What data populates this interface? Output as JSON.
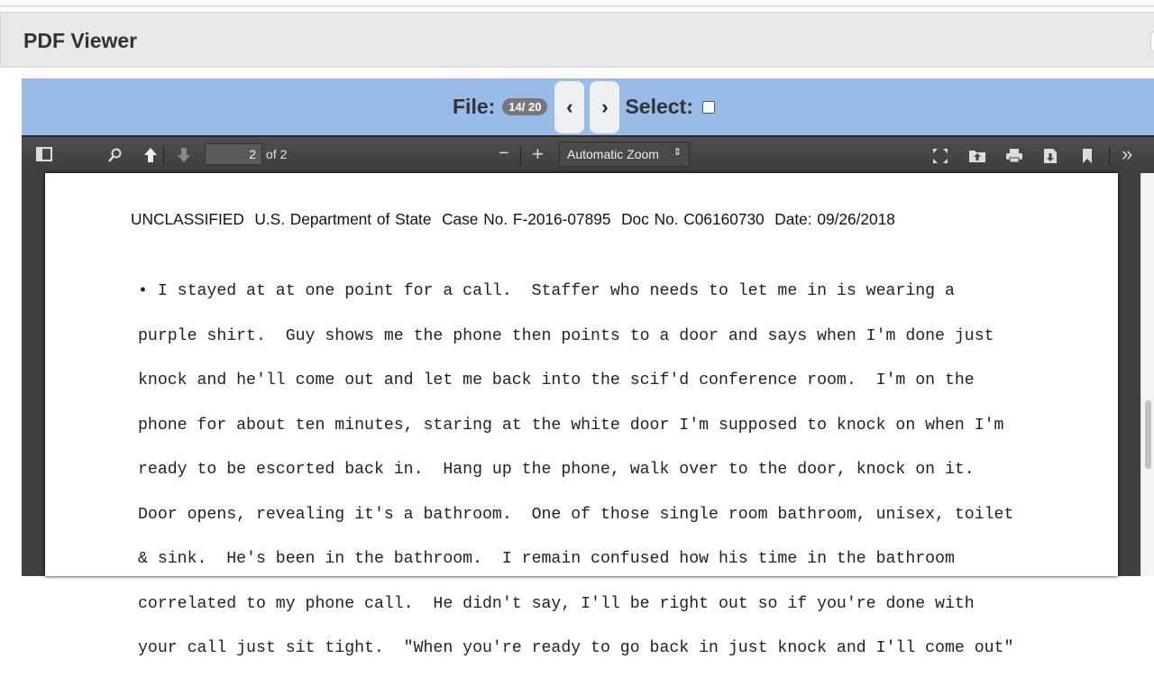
{
  "app": {
    "title": "PDF Viewer"
  },
  "nav": {
    "file_label": "File:",
    "file_counter": "14/ 20",
    "prev": "‹",
    "next": "›",
    "select_label": "Select:",
    "select_checked": false
  },
  "toolbar": {
    "page_number": "2",
    "page_of": "of 2",
    "zoom_out": "−",
    "zoom_in": "+",
    "zoom_value": "Automatic Zoom",
    "more": "»"
  },
  "document": {
    "header": "UNCLASSIFIED  U.S. Department of State  Case No. F-2016-07895  Doc No. C06160730  Date: 09/26/2018",
    "lines": [
      "• I stayed at at one point for a call.  Staffer who needs to let me in is wearing a",
      "purple shirt.  Guy shows me the phone then points to a door and says when I'm done just",
      "knock and he'll come out and let me back into the scif'd conference room.  I'm on the",
      "phone for about ten minutes, staring at the white door I'm supposed to knock on when I'm",
      "ready to be escorted back in.  Hang up the phone, walk over to the door, knock on it.",
      "Door opens, revealing it's a bathroom.  One of those single room bathroom, unisex, toilet",
      "& sink.  He's been in the bathroom.  I remain confused how his time in the bathroom",
      "correlated to my phone call.  He didn't say, I'll be right out so if you're done with",
      "your call just sit tight.  \"When you're ready to go back in just knock and I'll come out\""
    ]
  }
}
